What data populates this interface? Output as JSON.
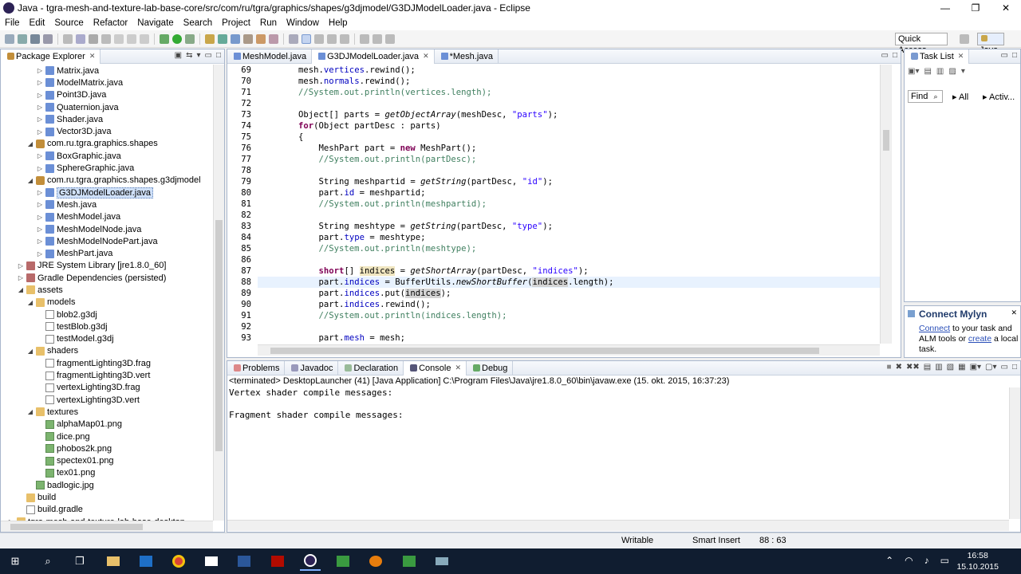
{
  "window": {
    "title": "Java - tgra-mesh-and-texture-lab-base-core/src/com/ru/tgra/graphics/shapes/g3djmodel/G3DJModelLoader.java - Eclipse",
    "minimize": "—",
    "maximize": "❐",
    "close": "✕"
  },
  "menu": [
    "File",
    "Edit",
    "Source",
    "Refactor",
    "Navigate",
    "Search",
    "Project",
    "Run",
    "Window",
    "Help"
  ],
  "toolbar": {
    "quick_access": "Quick Access",
    "perspective": "Java"
  },
  "package_explorer": {
    "title": "Package Explorer",
    "items": [
      {
        "label": "Matrix.java",
        "indent": 3,
        "icon": "java"
      },
      {
        "label": "ModelMatrix.java",
        "indent": 3,
        "icon": "java"
      },
      {
        "label": "Point3D.java",
        "indent": 3,
        "icon": "java"
      },
      {
        "label": "Quaternion.java",
        "indent": 3,
        "icon": "java"
      },
      {
        "label": "Shader.java",
        "indent": 3,
        "icon": "java"
      },
      {
        "label": "Vector3D.java",
        "indent": 3,
        "icon": "java"
      },
      {
        "label": "com.ru.tgra.graphics.shapes",
        "indent": 2,
        "icon": "pkg",
        "open": true
      },
      {
        "label": "BoxGraphic.java",
        "indent": 3,
        "icon": "java"
      },
      {
        "label": "SphereGraphic.java",
        "indent": 3,
        "icon": "java"
      },
      {
        "label": "com.ru.tgra.graphics.shapes.g3djmodel",
        "indent": 2,
        "icon": "pkg",
        "open": true
      },
      {
        "label": "G3DJModelLoader.java",
        "indent": 3,
        "icon": "java",
        "selected": true
      },
      {
        "label": "Mesh.java",
        "indent": 3,
        "icon": "java"
      },
      {
        "label": "MeshModel.java",
        "indent": 3,
        "icon": "java"
      },
      {
        "label": "MeshModelNode.java",
        "indent": 3,
        "icon": "java"
      },
      {
        "label": "MeshModelNodePart.java",
        "indent": 3,
        "icon": "java"
      },
      {
        "label": "MeshPart.java",
        "indent": 3,
        "icon": "java"
      },
      {
        "label": "JRE System Library [jre1.8.0_60]",
        "indent": 1,
        "icon": "lib"
      },
      {
        "label": "Gradle Dependencies (persisted)",
        "indent": 1,
        "icon": "lib"
      },
      {
        "label": "assets",
        "indent": 1,
        "icon": "folder",
        "open": true
      },
      {
        "label": "models",
        "indent": 2,
        "icon": "folder",
        "open": true
      },
      {
        "label": "blob2.g3dj",
        "indent": 3,
        "icon": "file",
        "leaf": true
      },
      {
        "label": "testBlob.g3dj",
        "indent": 3,
        "icon": "file",
        "leaf": true
      },
      {
        "label": "testModel.g3dj",
        "indent": 3,
        "icon": "file",
        "leaf": true
      },
      {
        "label": "shaders",
        "indent": 2,
        "icon": "folder",
        "open": true
      },
      {
        "label": "fragmentLighting3D.frag",
        "indent": 3,
        "icon": "file",
        "leaf": true
      },
      {
        "label": "fragmentLighting3D.vert",
        "indent": 3,
        "icon": "file",
        "leaf": true
      },
      {
        "label": "vertexLighting3D.frag",
        "indent": 3,
        "icon": "file",
        "leaf": true
      },
      {
        "label": "vertexLighting3D.vert",
        "indent": 3,
        "icon": "file",
        "leaf": true
      },
      {
        "label": "textures",
        "indent": 2,
        "icon": "folder",
        "open": true
      },
      {
        "label": "alphaMap01.png",
        "indent": 3,
        "icon": "img",
        "leaf": true
      },
      {
        "label": "dice.png",
        "indent": 3,
        "icon": "img",
        "leaf": true
      },
      {
        "label": "phobos2k.png",
        "indent": 3,
        "icon": "img",
        "leaf": true
      },
      {
        "label": "spectex01.png",
        "indent": 3,
        "icon": "img",
        "leaf": true
      },
      {
        "label": "tex01.png",
        "indent": 3,
        "icon": "img",
        "leaf": true
      },
      {
        "label": "badlogic.jpg",
        "indent": 2,
        "icon": "img",
        "leaf": true
      },
      {
        "label": "build",
        "indent": 1,
        "icon": "folder",
        "leaf": true
      },
      {
        "label": "build.gradle",
        "indent": 1,
        "icon": "file",
        "leaf": true
      },
      {
        "label": "tgra-mesh-and-texture-lab-base-desktop",
        "indent": 0,
        "icon": "folder"
      }
    ]
  },
  "editor": {
    "tabs": [
      {
        "label": "MeshModel.java",
        "active": false
      },
      {
        "label": "G3DJModelLoader.java",
        "active": true
      },
      {
        "label": "*Mesh.java",
        "active": false
      }
    ],
    "first_line": 69,
    "current_line": 88,
    "lines": [
      [
        [
          "p",
          "        mesh."
        ],
        [
          "f",
          "vertices"
        ],
        [
          "p",
          ".rewind();"
        ]
      ],
      [
        [
          "p",
          "        mesh."
        ],
        [
          "f",
          "normals"
        ],
        [
          "p",
          ".rewind();"
        ]
      ],
      [
        [
          "c",
          "        //System.out.println(vertices.length);"
        ]
      ],
      [
        [
          "p",
          ""
        ]
      ],
      [
        [
          "p",
          "        Object[] parts = "
        ],
        [
          "i",
          "getObjectArray"
        ],
        [
          "p",
          "(meshDesc, "
        ],
        [
          "s",
          "\"parts\""
        ],
        [
          "p",
          ");"
        ]
      ],
      [
        [
          "k",
          "        for"
        ],
        [
          "p",
          "(Object partDesc : parts)"
        ]
      ],
      [
        [
          "p",
          "        {"
        ]
      ],
      [
        [
          "p",
          "            MeshPart part = "
        ],
        [
          "k",
          "new"
        ],
        [
          "p",
          " MeshPart();"
        ]
      ],
      [
        [
          "c",
          "            //System.out.println(partDesc);"
        ]
      ],
      [
        [
          "p",
          ""
        ]
      ],
      [
        [
          "p",
          "            String meshpartid = "
        ],
        [
          "i",
          "getString"
        ],
        [
          "p",
          "(partDesc, "
        ],
        [
          "s",
          "\"id\""
        ],
        [
          "p",
          ");"
        ]
      ],
      [
        [
          "p",
          "            part."
        ],
        [
          "f",
          "id"
        ],
        [
          "p",
          " = meshpartid;"
        ]
      ],
      [
        [
          "c",
          "            //System.out.println(meshpartid);"
        ]
      ],
      [
        [
          "p",
          ""
        ]
      ],
      [
        [
          "p",
          "            String meshtype = "
        ],
        [
          "i",
          "getString"
        ],
        [
          "p",
          "(partDesc, "
        ],
        [
          "s",
          "\"type\""
        ],
        [
          "p",
          ");"
        ]
      ],
      [
        [
          "p",
          "            part."
        ],
        [
          "f",
          "type"
        ],
        [
          "p",
          " = meshtype;"
        ]
      ],
      [
        [
          "c",
          "            //System.out.println(meshtype);"
        ]
      ],
      [
        [
          "p",
          ""
        ]
      ],
      [
        [
          "k",
          "            short"
        ],
        [
          "p",
          "[] "
        ],
        [
          "h",
          "indices"
        ],
        [
          "p",
          " = "
        ],
        [
          "i",
          "getShortArray"
        ],
        [
          "p",
          "(partDesc, "
        ],
        [
          "s",
          "\"indices\""
        ],
        [
          "p",
          ");"
        ]
      ],
      [
        [
          "p",
          "            part."
        ],
        [
          "f",
          "indices"
        ],
        [
          "p",
          " = BufferUtils."
        ],
        [
          "i",
          "newShortBuffer"
        ],
        [
          "p",
          "("
        ],
        [
          "g",
          "indices"
        ],
        [
          "p",
          ".length);"
        ]
      ],
      [
        [
          "p",
          "            part."
        ],
        [
          "f",
          "indices"
        ],
        [
          "p",
          ".put("
        ],
        [
          "g",
          "indices"
        ],
        [
          "p",
          ");"
        ]
      ],
      [
        [
          "p",
          "            part."
        ],
        [
          "f",
          "indices"
        ],
        [
          "p",
          ".rewind();"
        ]
      ],
      [
        [
          "c",
          "            //System.out.println(indices.length);"
        ]
      ],
      [
        [
          "p",
          ""
        ]
      ],
      [
        [
          "p",
          "            part."
        ],
        [
          "f",
          "mesh"
        ],
        [
          "p",
          " = mesh;"
        ]
      ]
    ]
  },
  "task_list": {
    "title": "Task List",
    "find_placeholder": "Find",
    "all": "All",
    "activate": "Activ..."
  },
  "mylyn": {
    "title": "Connect Mylyn",
    "link1": "Connect",
    "text1": " to your task and ALM tools or ",
    "link2": "create",
    "text2": " a local task."
  },
  "bottom": {
    "tabs": [
      {
        "label": "Problems",
        "active": false
      },
      {
        "label": "Javadoc",
        "active": false
      },
      {
        "label": "Declaration",
        "active": false
      },
      {
        "label": "Console",
        "active": true
      },
      {
        "label": "Debug",
        "active": false
      }
    ],
    "launch": "<terminated> DesktopLauncher (41) [Java Application] C:\\Program Files\\Java\\jre1.8.0_60\\bin\\javaw.exe (15. okt. 2015, 16:37:23)",
    "output": [
      "Vertex shader compile messages:",
      "",
      "Fragment shader compile messages:"
    ]
  },
  "status": {
    "writable": "Writable",
    "insert": "Smart Insert",
    "position": "88 : 63"
  },
  "taskbar": {
    "time": "16:58",
    "date": "15.10.2015"
  }
}
